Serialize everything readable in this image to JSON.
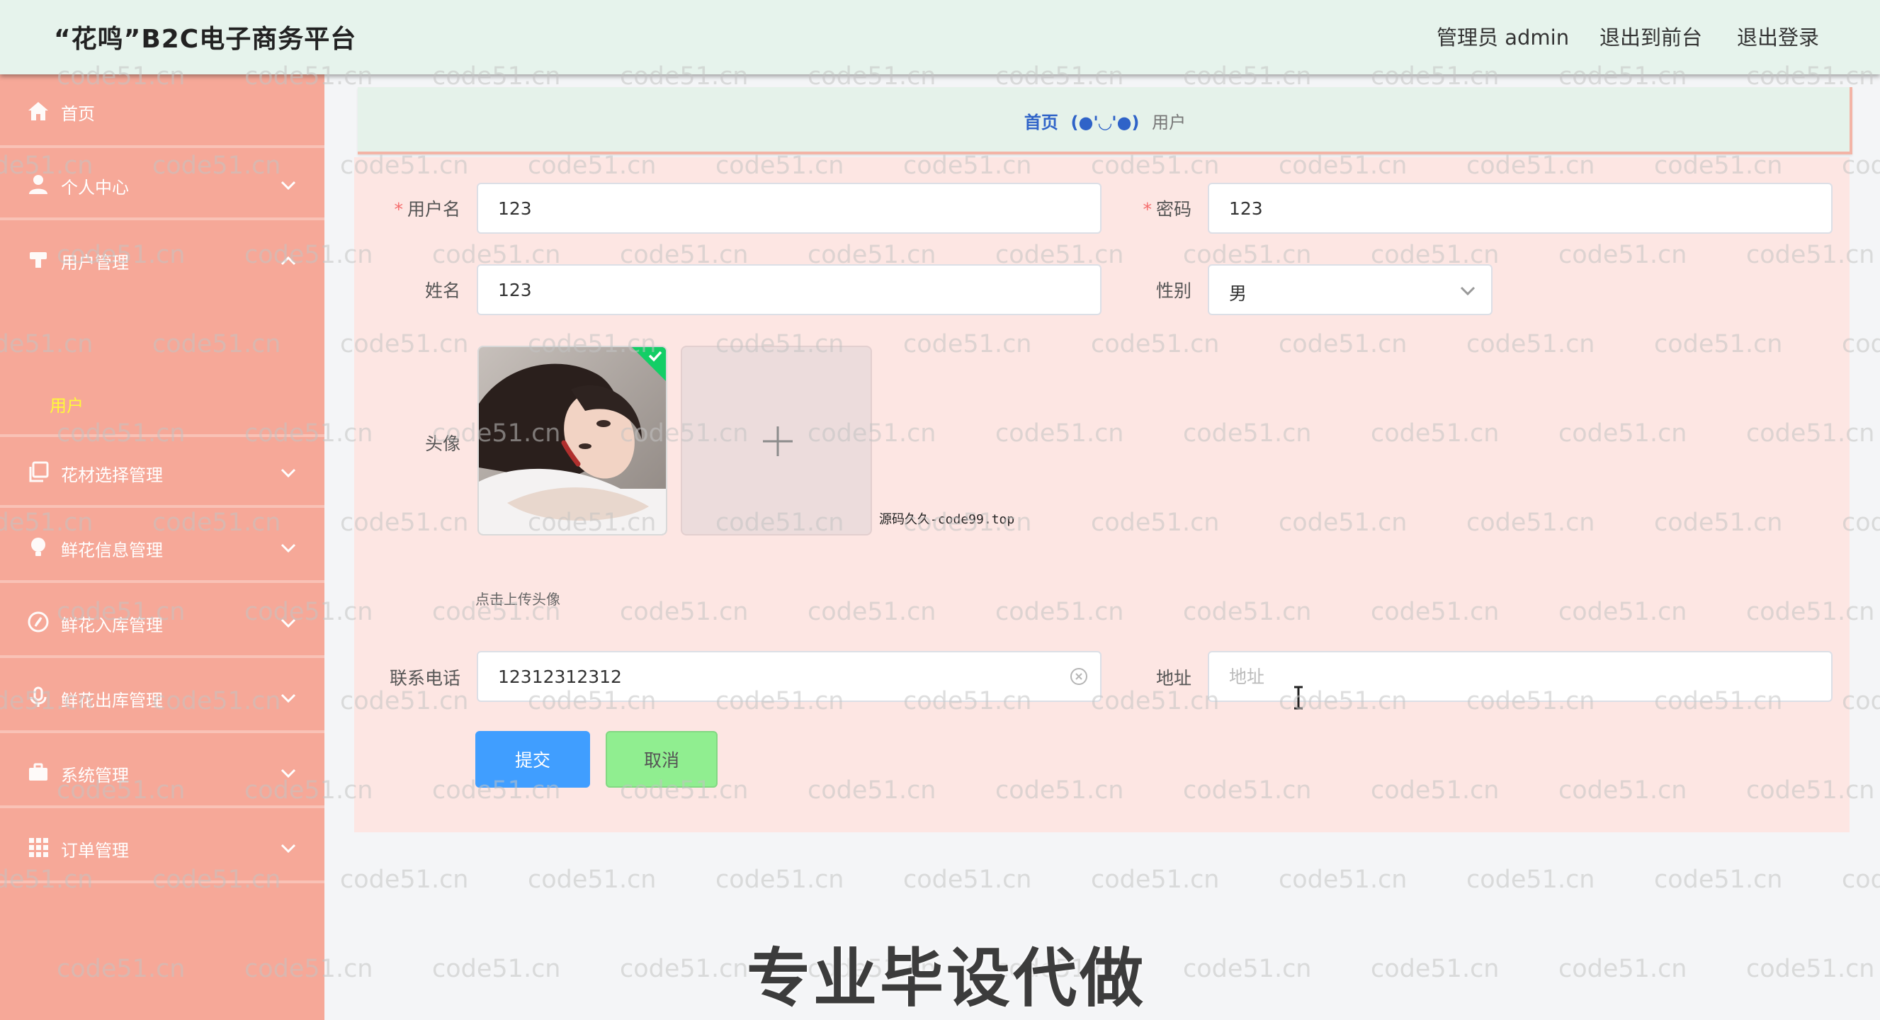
{
  "header": {
    "title": "“花鸣”B2C电子商务平台",
    "admin_label": "管理员 admin",
    "to_front_label": "退出到前台",
    "logout_label": "退出登录"
  },
  "sidebar": {
    "items": [
      {
        "label": "首页",
        "icon": "home-icon",
        "has_arrow": false
      },
      {
        "label": "个人中心",
        "icon": "user-icon",
        "has_arrow": true
      },
      {
        "label": "用户管理",
        "icon": "user-manage-icon",
        "has_arrow": true,
        "expanded": true
      },
      {
        "label": "花材选择管理",
        "icon": "copy-icon",
        "has_arrow": true
      },
      {
        "label": "鲜花信息管理",
        "icon": "bulb-icon",
        "has_arrow": true
      },
      {
        "label": "鲜花入库管理",
        "icon": "compass-icon",
        "has_arrow": true
      },
      {
        "label": "鲜花出库管理",
        "icon": "mic-icon",
        "has_arrow": true
      },
      {
        "label": "系统管理",
        "icon": "suitcase-icon",
        "has_arrow": true
      },
      {
        "label": "订单管理",
        "icon": "grid-icon",
        "has_arrow": true
      }
    ],
    "submenu_user": "用户",
    "active_color": "#fff93a"
  },
  "breadcrumb": {
    "home": "首页",
    "separator": "(●'◡'●)",
    "current": "用户"
  },
  "form": {
    "username": {
      "label": "用户名",
      "value": "123",
      "required": true
    },
    "password": {
      "label": "密码",
      "value": "123",
      "required": true
    },
    "name": {
      "label": "姓名",
      "value": "123"
    },
    "gender": {
      "label": "性别",
      "value": "男"
    },
    "avatar": {
      "label": "头像",
      "hint": "点击上传头像"
    },
    "phone": {
      "label": "联系电话",
      "value": "12312312312"
    },
    "address": {
      "label": "地址",
      "value": "",
      "placeholder": "地址"
    }
  },
  "buttons": {
    "submit": "提交",
    "cancel": "取消"
  },
  "overlay": {
    "watermark": "code51.cn",
    "source_note": "源码久久-code99.top",
    "caption": "专业毕设代做"
  },
  "colors": {
    "header_bg": "#e6f3ec",
    "sidebar_bg": "#f6a898",
    "form_bg": "#fde6e3",
    "primary": "#409eff",
    "cancel": "#90ee90",
    "breadcrumb_link": "#2f63c8"
  }
}
